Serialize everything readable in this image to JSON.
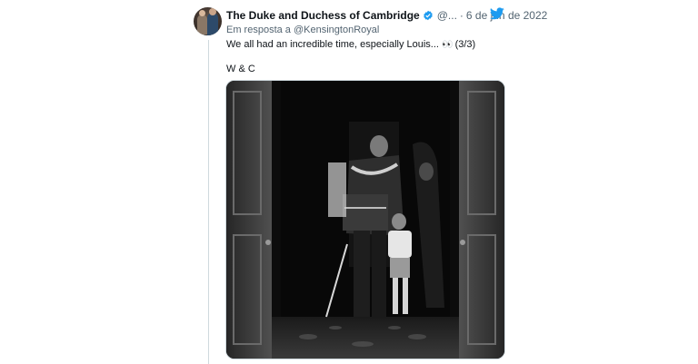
{
  "tweet": {
    "author_name": "The Duke and Duchess of Cambridge",
    "handle": "@...",
    "separator": "·",
    "date": "6 de jun de 2022",
    "reply_prefix": "Em resposta a",
    "reply_to": "@KensingtonRoyal",
    "text": "We all had an incredible time, especially Louis...",
    "emoji": "👀",
    "counter": "(3/3)",
    "signature": "W & C"
  },
  "icons": {
    "verified": "verified-badge-icon",
    "platform": "twitter-bird-icon"
  },
  "media": {
    "type": "photo",
    "description": "black-and-white"
  },
  "colors": {
    "accent": "#1d9bf0",
    "secondary_text": "#536471",
    "primary_text": "#0f1419",
    "thread_line": "#cfd9de"
  }
}
